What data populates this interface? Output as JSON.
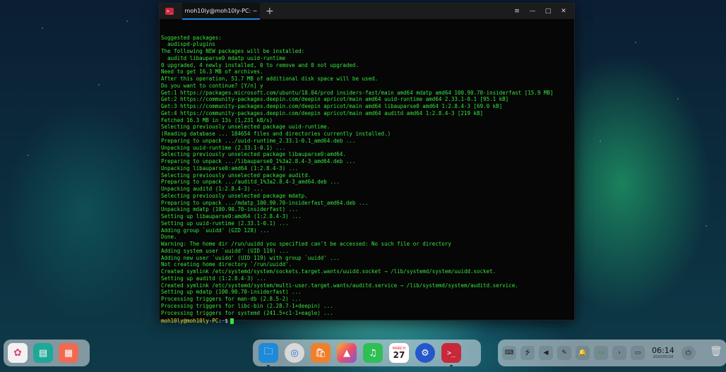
{
  "terminal": {
    "tab_title": "moh10ly@moh10ly-PC: ~",
    "new_tab_glyph": "+",
    "app_icon_glyph": ">_",
    "controls": {
      "menu": "≡",
      "minimize": "—",
      "maximize": "□",
      "close": "✕"
    },
    "lines": [
      "Suggested packages:",
      "  audispd-plugins",
      "The following NEW packages will be installed:",
      "  auditd libauparse0 mdatp uuid-runtime",
      "0 upgraded, 4 newly installed, 0 to remove and 0 not upgraded.",
      "Need to get 16.3 MB of archives.",
      "After this operation, 51.7 MB of additional disk space will be used.",
      "Do you want to continue? [Y/n] y",
      "Get:1 https://packages.microsoft.com/ubuntu/18.04/prod insiders-fast/main amd64 mdatp amd64 100.90.70-insiderfast [15.9 MB]",
      "Get:2 https://community-packages.deepin.com/deepin apricot/main amd64 uuid-runtime amd64 2.33.1-0.1 [95.1 kB]",
      "Get:3 https://community-packages.deepin.com/deepin apricot/main amd64 libauparse0 amd64 1:2.8.4-3 [69.0 kB]",
      "Get:4 https://community-packages.deepin.com/deepin apricot/main amd64 auditd amd64 1:2.8.4-3 [219 kB]",
      "Fetched 16.3 MB in 13s (1,231 kB/s)",
      "Selecting previously unselected package uuid-runtime.",
      "(Reading database ... 184654 files and directories currently installed.)",
      "Preparing to unpack .../uuid-runtime_2.33.1-0.1_amd64.deb ...",
      "Unpacking uuid-runtime (2.33.1-0.1) ...",
      "Selecting previously unselected package libauparse0:amd64.",
      "Preparing to unpack .../libauparse0_1%3a2.8.4-3_amd64.deb ...",
      "Unpacking libauparse0:amd64 (1:2.8.4-3) ...",
      "Selecting previously unselected package auditd.",
      "Preparing to unpack .../auditd_1%3a2.8.4-3_amd64.deb ...",
      "Unpacking auditd (1:2.8.4-3) ...",
      "Selecting previously unselected package mdatp.",
      "Preparing to unpack .../mdatp_100.90.70-insiderfast_amd64.deb ...",
      "Unpacking mdatp (100.90.70-insiderfast) ...",
      "Setting up libauparse0:amd64 (1:2.8.4-3) ...",
      "Setting up uuid-runtime (2.33.1-0.1) ...",
      "Adding group `uuidd' (GID 128) ...",
      "Done.",
      "Warning: The home dir /run/uuidd you specified can't be accessed: No such file or directory",
      "Adding system user `uuidd' (UID 119) ...",
      "Adding new user `uuidd' (UID 119) with group `uuidd' ...",
      "Not creating home directory `/run/uuidd'.",
      "Created symlink /etc/systemd/system/sockets.target.wants/uuidd.socket → /lib/systemd/system/uuidd.socket.",
      "Setting up auditd (1:2.8.4-3) ...",
      "Created symlink /etc/systemd/system/multi-user.target.wants/auditd.service → /lib/systemd/system/auditd.service.",
      "Setting up mdatp (100.90.70-insiderfast) ...",
      "Processing triggers for man-db (2.8.5-2) ...",
      "Processing triggers for libc-bin (2.28.7-1+deepin) ...",
      "Processing triggers for systemd (241.5+c1-1+eagle) ..."
    ],
    "prompt": {
      "user_host": "moh10ly@moh10ly-PC",
      "sep": ":",
      "path": "~",
      "symbol": "$"
    }
  },
  "dock": {
    "left": [
      {
        "name": "launcher-icon",
        "glyph": "✿"
      },
      {
        "name": "multitasking-icon",
        "glyph": "▤"
      },
      {
        "name": "workspace-grid-icon",
        "glyph": "▦"
      }
    ],
    "center": [
      {
        "name": "file-manager-icon",
        "glyph": "🗀"
      },
      {
        "name": "browser-icon",
        "glyph": "◎"
      },
      {
        "name": "app-store-icon",
        "glyph": "🛍"
      },
      {
        "name": "image-viewer-icon",
        "glyph": "▲"
      },
      {
        "name": "music-icon",
        "glyph": "♫"
      },
      {
        "name": "settings-icon",
        "glyph": "⚙"
      },
      {
        "name": "terminal-icon",
        "glyph": ">_"
      }
    ],
    "calendar": {
      "month": "MARCH",
      "day": "27"
    },
    "tray": [
      {
        "name": "keyboard-icon",
        "glyph": "⌨"
      },
      {
        "name": "usb-icon",
        "glyph": "⭍"
      },
      {
        "name": "volume-icon",
        "glyph": "◀"
      },
      {
        "name": "pen-icon",
        "glyph": "✎"
      },
      {
        "name": "notification-bell-icon",
        "glyph": "🔔"
      },
      {
        "name": "battery-icon",
        "glyph": "▭"
      },
      {
        "name": "expand-tray-icon",
        "glyph": "›"
      },
      {
        "name": "desktop-icon",
        "glyph": "▭"
      }
    ],
    "clock": {
      "time": "06:14",
      "date": "2020/05/18"
    },
    "power_glyph": "⏻",
    "trash_glyph": "🗑"
  }
}
